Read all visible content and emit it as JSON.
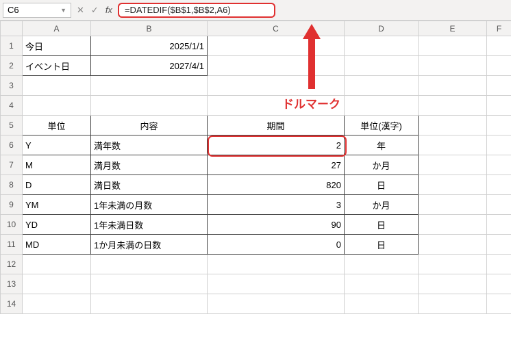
{
  "nameBox": "C6",
  "formulaBar": "=DATEDIF($B$1,$B$2,A6)",
  "colHeaders": [
    "A",
    "B",
    "C",
    "D",
    "E",
    "F"
  ],
  "rowHeaders": [
    "1",
    "2",
    "3",
    "4",
    "5",
    "6",
    "7",
    "8",
    "9",
    "10",
    "11",
    "12",
    "13",
    "14"
  ],
  "cells": {
    "A1": "今日",
    "B1": "2025/1/1",
    "A2": "イベント日",
    "B2": "2027/4/1",
    "A5": "単位",
    "B5": "内容",
    "C5": "期間",
    "D5": "単位(漢字)",
    "A6": "Y",
    "B6": "満年数",
    "C6": "2",
    "D6": "年",
    "A7": "M",
    "B7": "満月数",
    "C7": "27",
    "D7": "か月",
    "A8": "D",
    "B8": "満日数",
    "C8": "820",
    "D8": "日",
    "A9": "YM",
    "B9": "1年未満の月数",
    "C9": "3",
    "D9": "か月",
    "A10": "YD",
    "B10": "1年未満日数",
    "C10": "90",
    "D10": "日",
    "A11": "MD",
    "B11": "1か月未満の日数",
    "C11": "0",
    "D11": "日"
  },
  "annotation": "ドルマーク"
}
